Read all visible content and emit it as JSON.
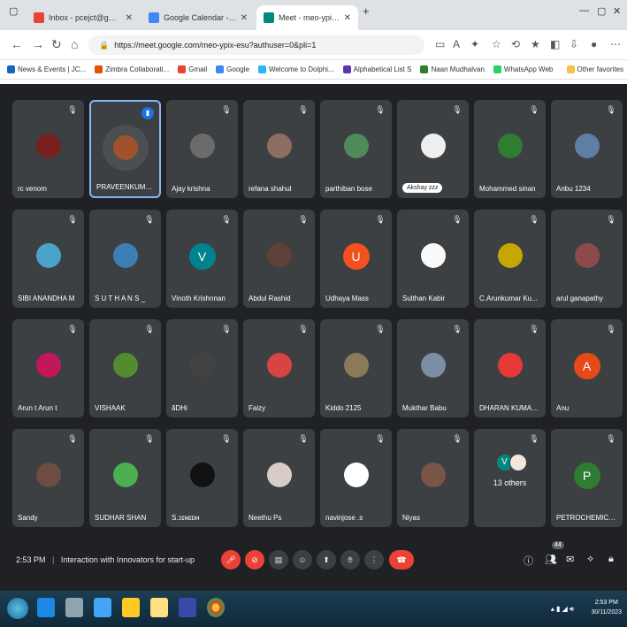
{
  "browser": {
    "tabs": [
      {
        "label": "Inbox - pcejct@gmail.com - Gm",
        "favicon_color": "#ea4335",
        "active": false
      },
      {
        "label": "Google Calendar - Thursday, N",
        "favicon_color": "#4285f4",
        "active": false
      },
      {
        "label": "Meet - meo-ypix-esu",
        "favicon_color": "#00897b",
        "active": true
      }
    ],
    "new_tab_label": "+",
    "url": "https://meet.google.com/meo-ypix-esu?authuser=0&pli=1",
    "bookmarks": [
      {
        "label": "News & Events | JC...",
        "icon_color": "#1565c0"
      },
      {
        "label": "Zimbra Collaborati...",
        "icon_color": "#e65100"
      },
      {
        "label": "Gmail",
        "icon_color": "#ea4335"
      },
      {
        "label": "Google",
        "icon_color": "#4285f4"
      },
      {
        "label": "Welcome to Dolphi...",
        "icon_color": "#29b6f6"
      },
      {
        "label": "Alphabetical List S",
        "icon_color": "#5e35b1"
      },
      {
        "label": "Naan Mudhalvan",
        "icon_color": "#2e7d32"
      },
      {
        "label": "WhatsApp Web",
        "icon_color": "#25d366"
      }
    ],
    "other_favorites": "Other favorites"
  },
  "participants": [
    {
      "name": "rc venom",
      "avatar_color": "#7a1f1f",
      "initial": "",
      "speaking": false
    },
    {
      "name": "PRAVEENKUMAR J",
      "avatar_color": "#a0522d",
      "initial": "",
      "speaking": true
    },
    {
      "name": "Ajay krishna",
      "avatar_color": "#6b6b6b",
      "initial": "",
      "speaking": false
    },
    {
      "name": "refana shahul",
      "avatar_color": "#8d6e63",
      "initial": "",
      "speaking": false
    },
    {
      "name": "parthiban bose",
      "avatar_color": "#4e8a5a",
      "initial": "",
      "speaking": false
    },
    {
      "name": "Akshay zzz",
      "avatar_color": "#eeeeee",
      "initial": "",
      "speaking": false,
      "pill": true
    },
    {
      "name": "Mohammed sinan",
      "avatar_color": "#2e7d32",
      "initial": "",
      "speaking": false
    },
    {
      "name": "Anbu 1234",
      "avatar_color": "#5c7fa3",
      "initial": "",
      "speaking": false
    },
    {
      "name": "SIBI ANANDHA M",
      "avatar_color": "#4aa3c8",
      "initial": "",
      "speaking": false
    },
    {
      "name": "S U T H A N S _",
      "avatar_color": "#3d7fb5",
      "initial": "",
      "speaking": false
    },
    {
      "name": "Vinoth Krishnnan",
      "avatar_color": "#00838f",
      "initial": "V",
      "speaking": false
    },
    {
      "name": "Abdul Rashid",
      "avatar_color": "#5d4037",
      "initial": "",
      "speaking": false
    },
    {
      "name": "Udhaya Mass",
      "avatar_color": "#f4511e",
      "initial": "U",
      "speaking": false
    },
    {
      "name": "Sulthan Kabir",
      "avatar_color": "#fafafa",
      "initial": "",
      "speaking": false
    },
    {
      "name": "C.Arunkumar Ku...",
      "avatar_color": "#c6a700",
      "initial": "",
      "speaking": false
    },
    {
      "name": "arul ganapathy",
      "avatar_color": "#8e4a4a",
      "initial": "",
      "speaking": false
    },
    {
      "name": "Arun t Arun t",
      "avatar_color": "#c2185b",
      "initial": "",
      "speaking": false
    },
    {
      "name": "VISHAAK",
      "avatar_color": "#558b2f",
      "initial": "",
      "speaking": false
    },
    {
      "name": "ãDHi",
      "avatar_color": "#424242",
      "initial": "",
      "speaking": false
    },
    {
      "name": "Faizy",
      "avatar_color": "#d84343",
      "initial": "",
      "speaking": false
    },
    {
      "name": "Kiddo 2125",
      "avatar_color": "#8a7a5a",
      "initial": "",
      "speaking": false
    },
    {
      "name": "Mukthar Babu",
      "avatar_color": "#7b8ea3",
      "initial": "",
      "speaking": false
    },
    {
      "name": "DHARAN KUMAR...",
      "avatar_color": "#e53935",
      "initial": "",
      "speaking": false
    },
    {
      "name": "Anu",
      "avatar_color": "#e64a19",
      "initial": "A",
      "speaking": false
    },
    {
      "name": "Sandy",
      "avatar_color": "#6d4c41",
      "initial": "",
      "speaking": false
    },
    {
      "name": "SUDHAR SHAN",
      "avatar_color": "#4caf50",
      "initial": "",
      "speaking": false
    },
    {
      "name": "S.ɔɪɴᴇᴅʜ",
      "avatar_color": "#111111",
      "initial": "",
      "speaking": false
    },
    {
      "name": "Neethu Ps",
      "avatar_color": "#d7ccc8",
      "initial": "",
      "speaking": false
    },
    {
      "name": "navinjose .s",
      "avatar_color": "#ffffff",
      "initial": "",
      "speaking": false
    },
    {
      "name": "Niyas",
      "avatar_color": "#795548",
      "initial": "",
      "speaking": false
    },
    {
      "name": "13 others",
      "avatar_color": "#00897b",
      "initial": "V",
      "speaking": false,
      "others": true
    },
    {
      "name": "PETROCHEMICA...",
      "avatar_color": "#2e7d32",
      "initial": "P",
      "speaking": false
    }
  ],
  "meeting": {
    "time": "2:53 PM",
    "separator": "|",
    "title": "Interaction with Innovators for start-up",
    "participant_count": "44"
  },
  "taskbar": {
    "time": "2:53 PM",
    "date": "30/11/2023"
  }
}
